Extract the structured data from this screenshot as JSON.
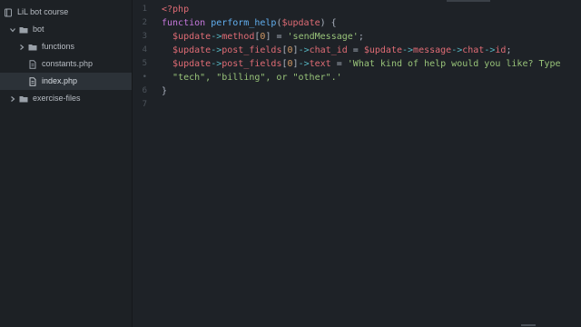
{
  "tree": {
    "root": {
      "label": "LiL bot course",
      "icon": "repo-icon"
    },
    "items": [
      {
        "label": "bot",
        "icon": "folder-open-icon",
        "expanded": true
      },
      {
        "label": "functions",
        "icon": "folder-icon",
        "expanded": false
      },
      {
        "label": "constants.php",
        "icon": "file-icon"
      },
      {
        "label": "index.php",
        "icon": "file-icon",
        "selected": true
      },
      {
        "label": "exercise-files",
        "icon": "folder-icon",
        "expanded": false
      }
    ]
  },
  "editor": {
    "language": "php",
    "line_numbers": [
      "1",
      "2",
      "3",
      "4",
      "5",
      "•",
      "6",
      "7"
    ],
    "lines": [
      [
        {
          "t": "<?php",
          "c": "tag"
        }
      ],
      [
        {
          "t": "function ",
          "c": "kw"
        },
        {
          "t": "perform_help",
          "c": "fn"
        },
        {
          "t": "(",
          "c": "punc"
        },
        {
          "t": "$update",
          "c": "var"
        },
        {
          "t": ") {",
          "c": "punc"
        }
      ],
      [
        {
          "t": "  ",
          "c": "punc"
        },
        {
          "t": "$update",
          "c": "var"
        },
        {
          "t": "->",
          "c": "op"
        },
        {
          "t": "method",
          "c": "prop"
        },
        {
          "t": "[",
          "c": "punc"
        },
        {
          "t": "0",
          "c": "num"
        },
        {
          "t": "] = ",
          "c": "punc"
        },
        {
          "t": "'sendMessage'",
          "c": "str"
        },
        {
          "t": ";",
          "c": "punc"
        }
      ],
      [
        {
          "t": "  ",
          "c": "punc"
        },
        {
          "t": "$update",
          "c": "var"
        },
        {
          "t": "->",
          "c": "op"
        },
        {
          "t": "post_fields",
          "c": "prop"
        },
        {
          "t": "[",
          "c": "punc"
        },
        {
          "t": "0",
          "c": "num"
        },
        {
          "t": "]",
          "c": "punc"
        },
        {
          "t": "->",
          "c": "op"
        },
        {
          "t": "chat_id",
          "c": "prop"
        },
        {
          "t": " = ",
          "c": "punc"
        },
        {
          "t": "$update",
          "c": "var"
        },
        {
          "t": "->",
          "c": "op"
        },
        {
          "t": "message",
          "c": "prop"
        },
        {
          "t": "->",
          "c": "op"
        },
        {
          "t": "chat",
          "c": "prop"
        },
        {
          "t": "->",
          "c": "op"
        },
        {
          "t": "id",
          "c": "prop"
        },
        {
          "t": ";",
          "c": "punc"
        }
      ],
      [
        {
          "t": "  ",
          "c": "punc"
        },
        {
          "t": "$update",
          "c": "var"
        },
        {
          "t": "->",
          "c": "op"
        },
        {
          "t": "post_fields",
          "c": "prop"
        },
        {
          "t": "[",
          "c": "punc"
        },
        {
          "t": "0",
          "c": "num"
        },
        {
          "t": "]",
          "c": "punc"
        },
        {
          "t": "->",
          "c": "op"
        },
        {
          "t": "text",
          "c": "prop"
        },
        {
          "t": " = ",
          "c": "punc"
        },
        {
          "t": "'What kind of help would you like? Type",
          "c": "str"
        }
      ],
      [
        {
          "t": "  ",
          "c": "punc"
        },
        {
          "t": "\"tech\", \"billing\", or \"other\".'",
          "c": "str"
        }
      ],
      [
        {
          "t": "}",
          "c": "punc"
        }
      ],
      []
    ]
  },
  "colors": {
    "sidebar_bg": "#1d2125",
    "editor_bg": "#1e2227",
    "selection_bg": "#2c3238"
  }
}
